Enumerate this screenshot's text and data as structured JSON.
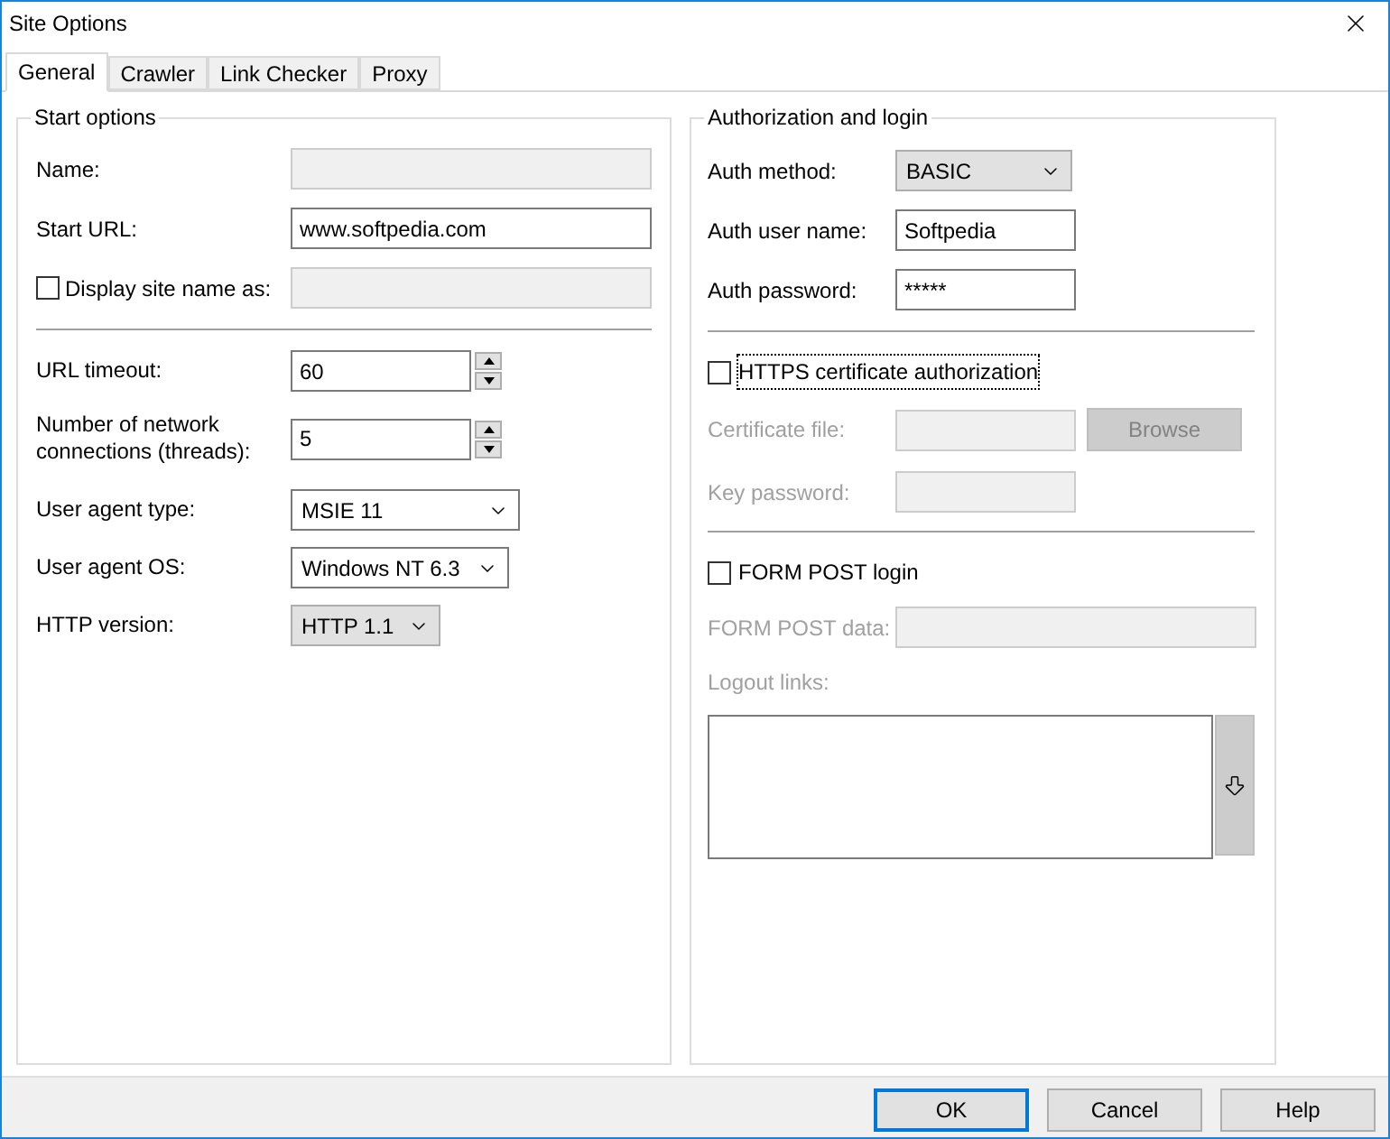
{
  "window": {
    "title": "Site Options"
  },
  "tabs": [
    {
      "label": "General",
      "selected": true
    },
    {
      "label": "Crawler",
      "selected": false
    },
    {
      "label": "Link Checker",
      "selected": false
    },
    {
      "label": "Proxy",
      "selected": false
    }
  ],
  "start_options": {
    "title": "Start options",
    "fields": [
      {
        "kind": "text",
        "label": "Name:",
        "disabled": true
      },
      {
        "kind": "text",
        "label": "Start URL:",
        "value": "www.softpedia.com",
        "disabled": false
      },
      {
        "kind": "checkbox_text",
        "label": "Display site name as:",
        "checked": false,
        "disabled": true
      }
    ],
    "settings": [
      {
        "kind": "spinner",
        "label": "URL timeout:",
        "value": "60"
      },
      {
        "kind": "spinner",
        "label": "Number of network connections (threads):",
        "value": "5"
      },
      {
        "kind": "combo",
        "label": "User agent type:",
        "value": "MSIE 11"
      },
      {
        "kind": "combo",
        "label": "User agent OS:",
        "value": "Windows NT 6.3"
      },
      {
        "kind": "list",
        "label": "HTTP version:",
        "value": "HTTP 1.1"
      }
    ]
  },
  "authorization": {
    "title": "Authorization and login",
    "fields": [
      {
        "kind": "list",
        "label": "Auth method:",
        "value": "BASIC"
      },
      {
        "kind": "text",
        "label": "Auth user name:",
        "value": "Softpedia"
      },
      {
        "kind": "text",
        "label": "Auth password:",
        "value": "*****"
      }
    ],
    "https": {
      "label": "HTTPS certificate authorization",
      "checked": false,
      "focused": true
    },
    "certificate_file": {
      "label": "Certificate file:",
      "disabled": true,
      "button": "Browse"
    },
    "key_password": {
      "label": "Key password:",
      "disabled": true
    },
    "form_post": {
      "label": "FORM POST login",
      "checked": false,
      "focused": false
    },
    "form_post_data": {
      "label": "FORM POST data:",
      "disabled": true
    },
    "logout_links": {
      "label": "Logout links:",
      "disabled": true
    }
  },
  "buttons": [
    {
      "label": "OK",
      "default": true
    },
    {
      "label": "Cancel",
      "default": false
    },
    {
      "label": "Help",
      "default": false
    }
  ]
}
